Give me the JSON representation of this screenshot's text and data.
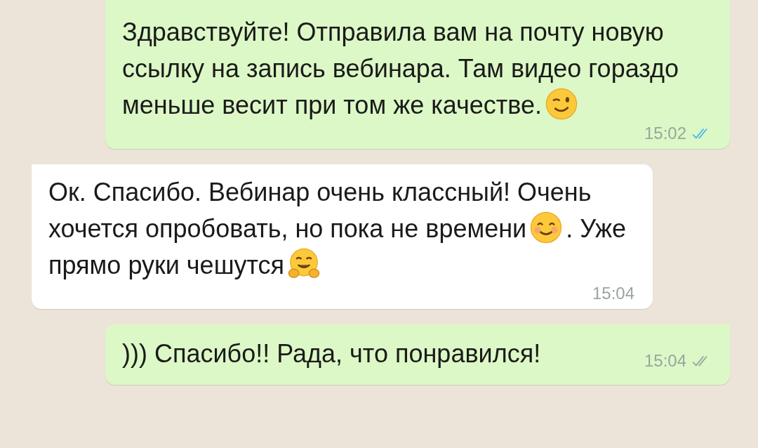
{
  "messages": [
    {
      "kind": "outgoing",
      "parts": [
        {
          "kind": "text",
          "text": "Здравствуйте! Отправила вам на почту новую ссылку на запись вебинара. Там видео гораздо меньше весит при том же качестве."
        },
        {
          "kind": "emoji"
        }
      ],
      "time": "15:02",
      "read": true
    },
    {
      "kind": "incoming",
      "parts": [
        {
          "kind": "text",
          "text": "Ок. Спасибо. Вебинар очень классный! Очень хочется опробовать, но пока не времени"
        },
        {
          "kind": "emoji"
        },
        {
          "kind": "text",
          "text": ". Уже прямо руки чешутся"
        },
        {
          "kind": "emoji"
        }
      ],
      "time": "15:04"
    },
    {
      "kind": "outgoing",
      "parts": [
        {
          "kind": "text",
          "text": "))) Спасибо!! Рада, что понравился!"
        }
      ],
      "time": "15:04",
      "read": false
    }
  ]
}
